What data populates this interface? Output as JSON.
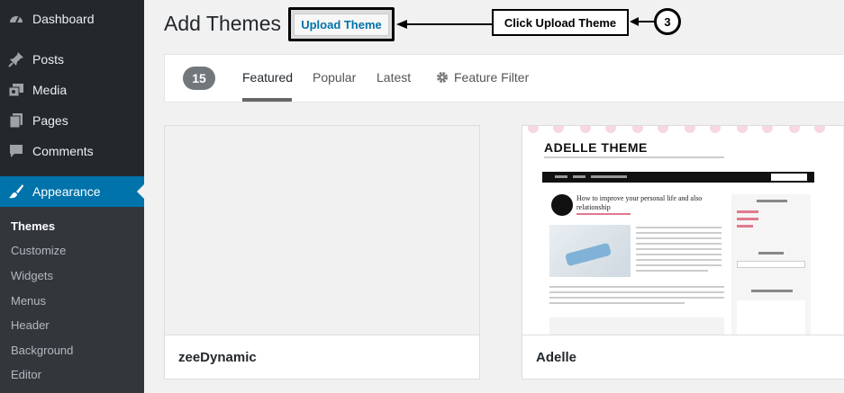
{
  "sidebar": {
    "menu": [
      {
        "label": "Dashboard",
        "icon": "dashboard-icon"
      },
      {
        "label": "Posts",
        "icon": "pin-icon"
      },
      {
        "label": "Media",
        "icon": "media-icon"
      },
      {
        "label": "Pages",
        "icon": "pages-icon"
      },
      {
        "label": "Comments",
        "icon": "comment-icon"
      },
      {
        "label": "Appearance",
        "icon": "brush-icon"
      }
    ],
    "submenu": [
      "Themes",
      "Customize",
      "Widgets",
      "Menus",
      "Header",
      "Background",
      "Editor"
    ]
  },
  "header": {
    "title": "Add Themes",
    "upload_label": "Upload Theme"
  },
  "annotation": {
    "callout": "Click Upload Theme",
    "step": "3"
  },
  "filter": {
    "count": "15",
    "tabs": [
      "Featured",
      "Popular",
      "Latest"
    ],
    "feature_filter": "Feature Filter",
    "active_tab": "Featured"
  },
  "themes": [
    {
      "name": "zeeDynamic"
    },
    {
      "name": "Adelle",
      "preview": {
        "logo": "ADELLE THEME",
        "post_title": "How to improve your personal life and also relationship"
      }
    }
  ],
  "colors": {
    "sidebar_bg": "#23282d",
    "active_bg": "#0073aa",
    "link": "#0073aa"
  }
}
